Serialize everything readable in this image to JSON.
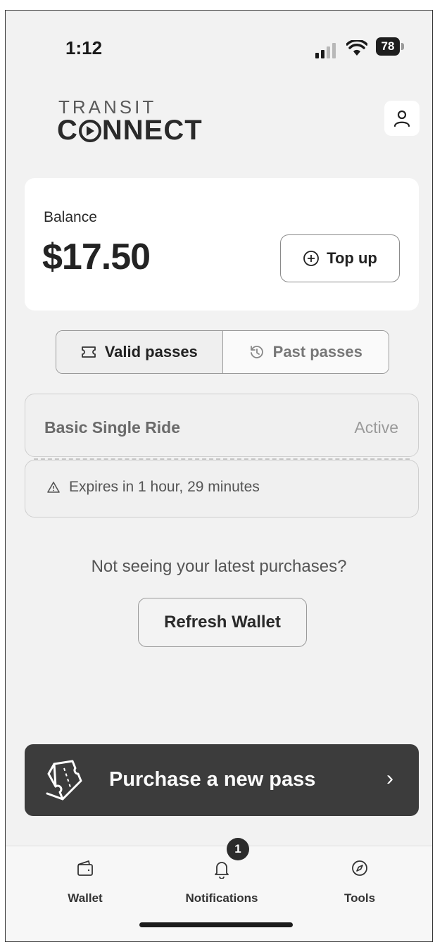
{
  "status_bar": {
    "time": "1:12",
    "battery": "78"
  },
  "logo": {
    "line1": "TRANSIT",
    "line2_pre": "C",
    "line2_post": "NNECT"
  },
  "balance": {
    "label": "Balance",
    "amount": "$17.50",
    "topup_label": "Top up"
  },
  "tabs": [
    {
      "label": "Valid passes",
      "icon": "ticket-icon",
      "active": true
    },
    {
      "label": "Past passes",
      "icon": "history-icon",
      "active": false
    }
  ],
  "pass": {
    "name": "Basic Single Ride",
    "status": "Active",
    "expires": "Expires in 1 hour, 29 minutes"
  },
  "refresh": {
    "prompt": "Not seeing your latest purchases?",
    "button_label": "Refresh Wallet"
  },
  "purchase": {
    "label": "Purchase a new pass",
    "icon": "ticket-icon",
    "chevron": "›"
  },
  "nav": [
    {
      "label": "Wallet",
      "icon": "wallet-icon"
    },
    {
      "label": "Notifications",
      "icon": "bell-icon",
      "badge": "1"
    },
    {
      "label": "Tools",
      "icon": "compass-icon"
    }
  ],
  "colors": {
    "background": "#f2f2f2",
    "card": "#ffffff",
    "purchase_bar": "#3c3c3c",
    "text": "#2a2a2a"
  }
}
